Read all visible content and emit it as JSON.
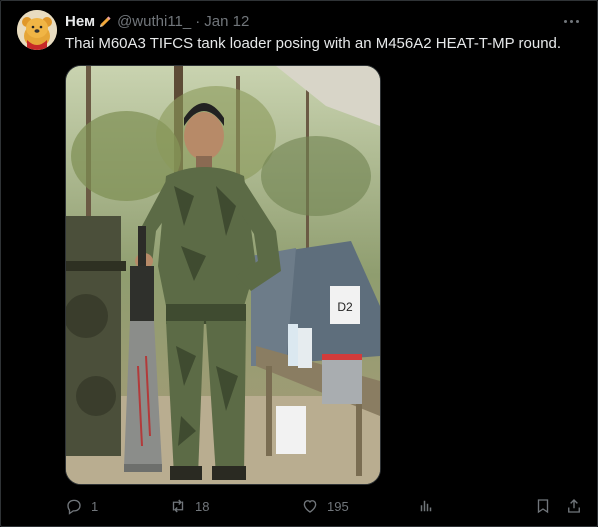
{
  "author": {
    "display_name": "Нем",
    "handle": "@wuthi11_",
    "separator": "·",
    "date": "Jan 12",
    "avatar_icon": "winnie-the-pooh-avatar",
    "name_emoji_icon": "pencil-icon"
  },
  "tweet": {
    "text": "Thai M60A3 TIFCS tank loader posing with an M456A2 HEAT-T-MP round."
  },
  "media": {
    "sign_label": "D2",
    "description_icon": "photo"
  },
  "actions": {
    "reply_count": "1",
    "retweet_count": "18",
    "like_count": "195",
    "views_icon": "bar-chart-icon",
    "bookmark_icon": "bookmark-icon",
    "share_icon": "share-icon"
  },
  "colors": {
    "background": "#000000",
    "text_primary": "#e7e9ea",
    "text_secondary": "#71767b",
    "border": "#2f3336"
  }
}
